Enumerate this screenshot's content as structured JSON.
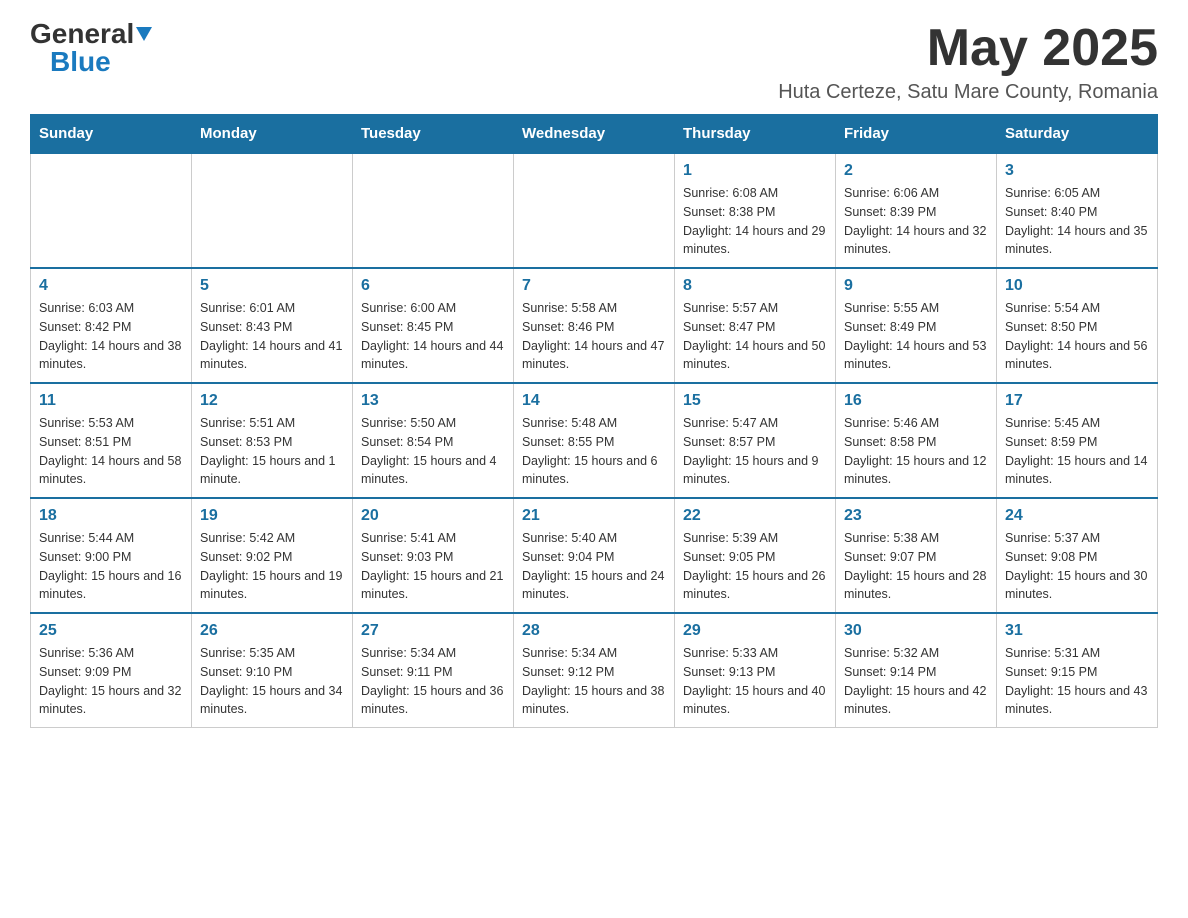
{
  "header": {
    "logo_general": "General",
    "logo_blue": "Blue",
    "month_title": "May 2025",
    "subtitle": "Huta Certeze, Satu Mare County, Romania"
  },
  "days_of_week": [
    "Sunday",
    "Monday",
    "Tuesday",
    "Wednesday",
    "Thursday",
    "Friday",
    "Saturday"
  ],
  "weeks": [
    [
      {
        "day": "",
        "info": ""
      },
      {
        "day": "",
        "info": ""
      },
      {
        "day": "",
        "info": ""
      },
      {
        "day": "",
        "info": ""
      },
      {
        "day": "1",
        "info": "Sunrise: 6:08 AM\nSunset: 8:38 PM\nDaylight: 14 hours and 29 minutes."
      },
      {
        "day": "2",
        "info": "Sunrise: 6:06 AM\nSunset: 8:39 PM\nDaylight: 14 hours and 32 minutes."
      },
      {
        "day": "3",
        "info": "Sunrise: 6:05 AM\nSunset: 8:40 PM\nDaylight: 14 hours and 35 minutes."
      }
    ],
    [
      {
        "day": "4",
        "info": "Sunrise: 6:03 AM\nSunset: 8:42 PM\nDaylight: 14 hours and 38 minutes."
      },
      {
        "day": "5",
        "info": "Sunrise: 6:01 AM\nSunset: 8:43 PM\nDaylight: 14 hours and 41 minutes."
      },
      {
        "day": "6",
        "info": "Sunrise: 6:00 AM\nSunset: 8:45 PM\nDaylight: 14 hours and 44 minutes."
      },
      {
        "day": "7",
        "info": "Sunrise: 5:58 AM\nSunset: 8:46 PM\nDaylight: 14 hours and 47 minutes."
      },
      {
        "day": "8",
        "info": "Sunrise: 5:57 AM\nSunset: 8:47 PM\nDaylight: 14 hours and 50 minutes."
      },
      {
        "day": "9",
        "info": "Sunrise: 5:55 AM\nSunset: 8:49 PM\nDaylight: 14 hours and 53 minutes."
      },
      {
        "day": "10",
        "info": "Sunrise: 5:54 AM\nSunset: 8:50 PM\nDaylight: 14 hours and 56 minutes."
      }
    ],
    [
      {
        "day": "11",
        "info": "Sunrise: 5:53 AM\nSunset: 8:51 PM\nDaylight: 14 hours and 58 minutes."
      },
      {
        "day": "12",
        "info": "Sunrise: 5:51 AM\nSunset: 8:53 PM\nDaylight: 15 hours and 1 minute."
      },
      {
        "day": "13",
        "info": "Sunrise: 5:50 AM\nSunset: 8:54 PM\nDaylight: 15 hours and 4 minutes."
      },
      {
        "day": "14",
        "info": "Sunrise: 5:48 AM\nSunset: 8:55 PM\nDaylight: 15 hours and 6 minutes."
      },
      {
        "day": "15",
        "info": "Sunrise: 5:47 AM\nSunset: 8:57 PM\nDaylight: 15 hours and 9 minutes."
      },
      {
        "day": "16",
        "info": "Sunrise: 5:46 AM\nSunset: 8:58 PM\nDaylight: 15 hours and 12 minutes."
      },
      {
        "day": "17",
        "info": "Sunrise: 5:45 AM\nSunset: 8:59 PM\nDaylight: 15 hours and 14 minutes."
      }
    ],
    [
      {
        "day": "18",
        "info": "Sunrise: 5:44 AM\nSunset: 9:00 PM\nDaylight: 15 hours and 16 minutes."
      },
      {
        "day": "19",
        "info": "Sunrise: 5:42 AM\nSunset: 9:02 PM\nDaylight: 15 hours and 19 minutes."
      },
      {
        "day": "20",
        "info": "Sunrise: 5:41 AM\nSunset: 9:03 PM\nDaylight: 15 hours and 21 minutes."
      },
      {
        "day": "21",
        "info": "Sunrise: 5:40 AM\nSunset: 9:04 PM\nDaylight: 15 hours and 24 minutes."
      },
      {
        "day": "22",
        "info": "Sunrise: 5:39 AM\nSunset: 9:05 PM\nDaylight: 15 hours and 26 minutes."
      },
      {
        "day": "23",
        "info": "Sunrise: 5:38 AM\nSunset: 9:07 PM\nDaylight: 15 hours and 28 minutes."
      },
      {
        "day": "24",
        "info": "Sunrise: 5:37 AM\nSunset: 9:08 PM\nDaylight: 15 hours and 30 minutes."
      }
    ],
    [
      {
        "day": "25",
        "info": "Sunrise: 5:36 AM\nSunset: 9:09 PM\nDaylight: 15 hours and 32 minutes."
      },
      {
        "day": "26",
        "info": "Sunrise: 5:35 AM\nSunset: 9:10 PM\nDaylight: 15 hours and 34 minutes."
      },
      {
        "day": "27",
        "info": "Sunrise: 5:34 AM\nSunset: 9:11 PM\nDaylight: 15 hours and 36 minutes."
      },
      {
        "day": "28",
        "info": "Sunrise: 5:34 AM\nSunset: 9:12 PM\nDaylight: 15 hours and 38 minutes."
      },
      {
        "day": "29",
        "info": "Sunrise: 5:33 AM\nSunset: 9:13 PM\nDaylight: 15 hours and 40 minutes."
      },
      {
        "day": "30",
        "info": "Sunrise: 5:32 AM\nSunset: 9:14 PM\nDaylight: 15 hours and 42 minutes."
      },
      {
        "day": "31",
        "info": "Sunrise: 5:31 AM\nSunset: 9:15 PM\nDaylight: 15 hours and 43 minutes."
      }
    ]
  ]
}
